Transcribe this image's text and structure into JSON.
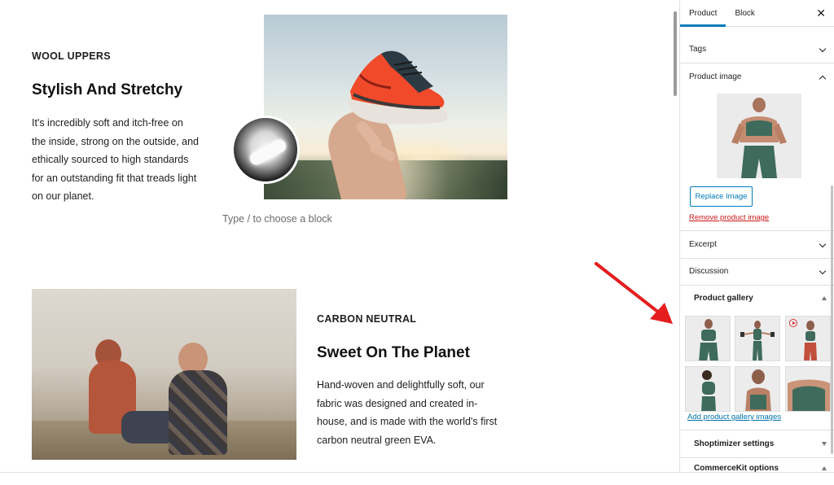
{
  "editor": {
    "block1": {
      "eyebrow": "WOOL UPPERS",
      "heading": "Stylish And Stretchy",
      "lines": [
        "It's incredibly soft and itch-free on",
        "the inside, strong on the outside, and",
        "ethically sourced to high standards",
        "for an outstanding fit that treads light",
        "on our planet."
      ]
    },
    "placeholder": "Type / to choose a block",
    "block2": {
      "eyebrow": "CARBON NEUTRAL",
      "heading": "Sweet On The Planet",
      "lines": [
        "Hand-woven and delightfully soft, our",
        "fabric was designed and created in-",
        "house, and is made with the world's first",
        "carbon neutral green EVA."
      ]
    }
  },
  "sidebar": {
    "tabs": [
      "Product",
      "Block"
    ],
    "active_tab": "Product",
    "close_icon": "close-icon",
    "panels": {
      "tags": "Tags",
      "product_image": "Product image",
      "replace_image": "Replace Image",
      "remove_image": "Remove product image",
      "excerpt": "Excerpt",
      "discussion": "Discussion",
      "product_gallery": "Product gallery",
      "add_gallery": "Add product gallery images",
      "shoptimizer": "Shoptimizer settings",
      "commercekit": "CommerceKit options"
    }
  },
  "colors": {
    "accent": "#007cba",
    "link": "#0073aa",
    "danger": "#cc1818",
    "arrow": "#e41e1e",
    "apparel": "#3e6b5c"
  }
}
